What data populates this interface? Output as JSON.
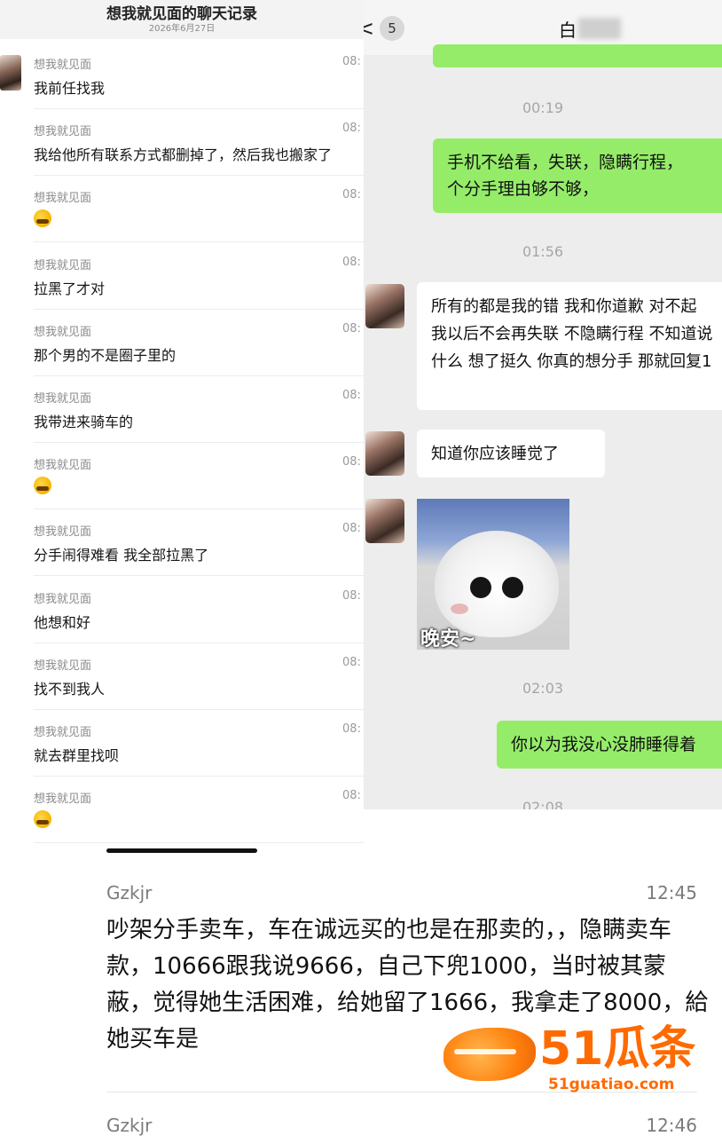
{
  "forwarded_record": {
    "title": "想我就见面的聊天记录",
    "date": "2026年6月27日",
    "messages": [
      {
        "sender": "想我就见面",
        "time": "08:",
        "text": "我前任找我"
      },
      {
        "sender": "想我就见面",
        "time": "08:",
        "text": "我给他所有联系方式都删掉了，然后我也搬家了"
      },
      {
        "sender": "想我就见面",
        "time": "08:",
        "text": "",
        "emoji": "laughing-tears-emoji"
      },
      {
        "sender": "想我就见面",
        "time": "08:",
        "text": "拉黑了才对"
      },
      {
        "sender": "想我就见面",
        "time": "08:",
        "text": "那个男的不是圈子里的"
      },
      {
        "sender": "想我就见面",
        "time": "08:",
        "text": "我带进来骑车的"
      },
      {
        "sender": "想我就见面",
        "time": "08:",
        "text": "",
        "emoji": "laughing-tears-emoji"
      },
      {
        "sender": "想我就见面",
        "time": "08:",
        "text": "分手闹得难看 我全部拉黑了"
      },
      {
        "sender": "想我就见面",
        "time": "08:",
        "text": "他想和好"
      },
      {
        "sender": "想我就见面",
        "time": "08:",
        "text": "找不到我人"
      },
      {
        "sender": "想我就见面",
        "time": "08:",
        "text": "就去群里找呗"
      },
      {
        "sender": "想我就见面",
        "time": "08:",
        "text": "",
        "emoji": "laughing-tears-emoji"
      }
    ]
  },
  "wechat": {
    "back_icon": "<",
    "unread_count": "5",
    "contact_name": "白",
    "timestamps": [
      "00:19",
      "01:56",
      "02:03",
      "02:08"
    ],
    "msg_green_1": "手机不给看，失联，隐瞒行程，",
    "msg_green_1b": "个分手理由够不够，",
    "msg_white_1": "所有的都是我的错 我和你道歉 对不起 我以后不会再失联 不隐瞒行程 不知道说什么 想了挺久 你真的想分手 那就回复1",
    "msg_white_2": "知道你应该睡觉了",
    "sticker_caption": "晚安~",
    "msg_green_2": "你以为我没心没肺睡得着"
  },
  "comments": [
    {
      "user": "Gzkjr",
      "time": "12:45",
      "text": "吵架分手卖车，车在诚远买的也是在那卖的，，隐瞒卖车款，10666跟我说9666，自己下兜1000，当时被其蒙蔽，觉得她生活困难，给她留了1666，我拿走了8000，給她买车是"
    },
    {
      "user": "Gzkjr",
      "time": "12:46"
    }
  ],
  "watermark": {
    "main": "51瓜条",
    "url": "51guatiao.com"
  },
  "colors": {
    "wechat_green": "#95ec69",
    "chat_bg": "#ededed",
    "watermark_orange": "#ff6a00"
  }
}
